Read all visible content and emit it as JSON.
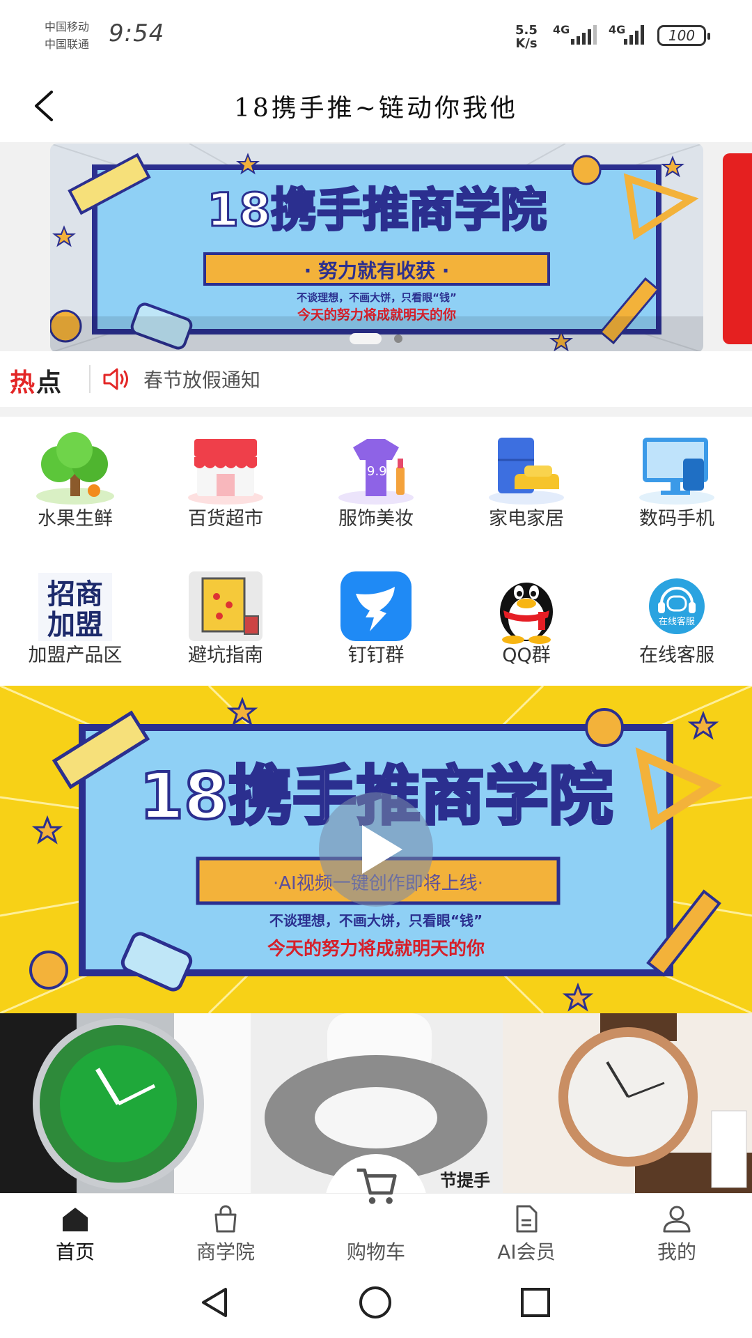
{
  "status_bar": {
    "carrier_1": "中国移动",
    "carrier_2": "中国联通",
    "time": "9:54",
    "net_speed_value": "5.5",
    "net_speed_unit": "K/s",
    "signal_1_label": "4G",
    "signal_2_label": "4G",
    "battery": "100"
  },
  "header": {
    "title": "18携手推~链动你我他"
  },
  "banner": {
    "heading": "18携手推商学院",
    "ribbon": "· 努力就有收获 ·",
    "line_1": "不谈理想，不画大饼，只看眼“钱”",
    "line_2": "今天的努力将成就明天的你",
    "active_slide": 1,
    "slide_count": 2
  },
  "hot_news": {
    "logo_part_1": "热",
    "logo_part_2": "点",
    "text": "春节放假通知"
  },
  "categories": [
    {
      "label": "水果生鲜",
      "icon": "tree-icon"
    },
    {
      "label": "百货超市",
      "icon": "store-icon"
    },
    {
      "label": "服饰美妆",
      "icon": "clothes-icon"
    },
    {
      "label": "家电家居",
      "icon": "appliance-icon"
    },
    {
      "label": "数码手机",
      "icon": "computer-icon"
    },
    {
      "label": "加盟产品区",
      "icon": "franchise-icon"
    },
    {
      "label": "避坑指南",
      "icon": "guide-icon"
    },
    {
      "label": "钉钉群",
      "icon": "dingtalk-icon"
    },
    {
      "label": "QQ群",
      "icon": "qq-penguin-icon"
    },
    {
      "label": "在线客服",
      "icon": "customer-service-icon"
    }
  ],
  "franchise_icon_text": [
    "招商",
    "加盟"
  ],
  "service_icon_text": "在线客服",
  "video": {
    "heading": "18携手推商学院",
    "ribbon": "·AI视频一键创作即将上线·",
    "line_1": "不谈理想，不画大饼，只看眼“钱”",
    "line_2": "今天的努力将成就明天的你"
  },
  "products": [
    {
      "name": "green-watch"
    },
    {
      "name": "toilet-seat-cover",
      "caption": "节提手"
    },
    {
      "name": "gold-watch"
    }
  ],
  "tabs": [
    {
      "label": "首页",
      "icon": "home-icon",
      "active": true
    },
    {
      "label": "商学院",
      "icon": "bag-icon"
    },
    {
      "label": "购物车",
      "icon": "cart-icon"
    },
    {
      "label": "AI会员",
      "icon": "document-icon"
    },
    {
      "label": "我的",
      "icon": "user-icon"
    }
  ],
  "colors": {
    "accent_red": "#e32626",
    "banner_blue": "#8fd0f5",
    "banner_frame": "#2b2f8f",
    "ribbon_orange": "#f3b23a",
    "video_yellow": "#f7d117"
  }
}
